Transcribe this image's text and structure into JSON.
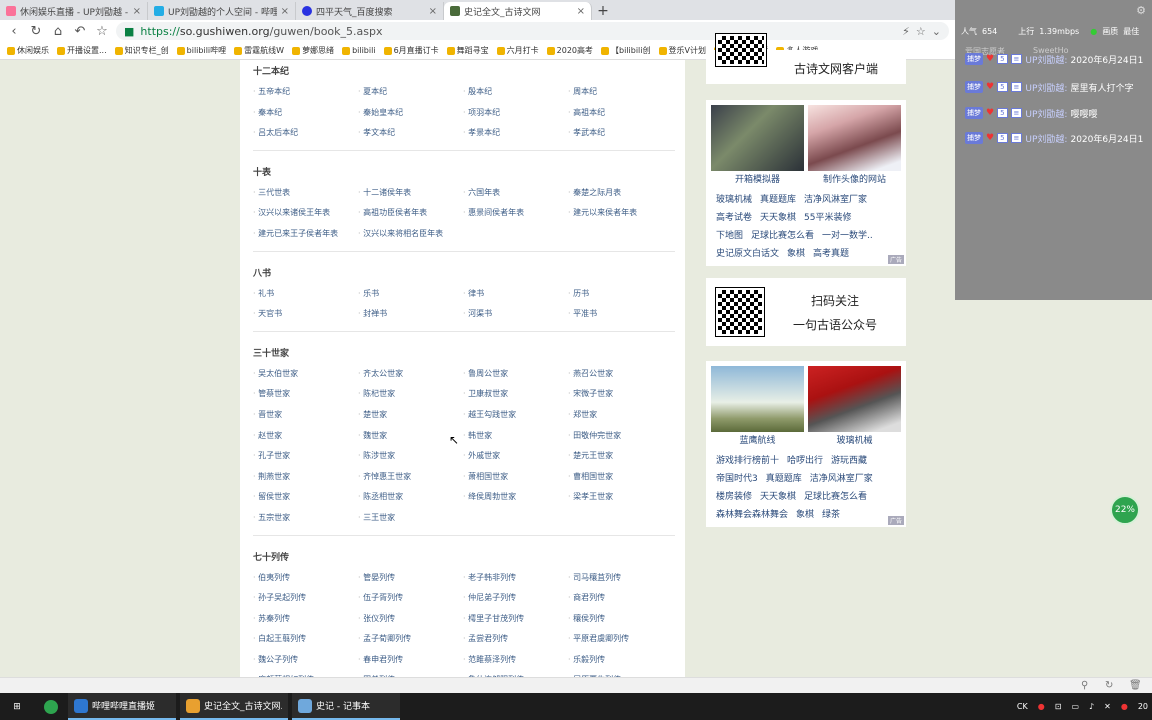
{
  "browser": {
    "tabs": [
      {
        "label": "休闲娱乐直播 - UP刘勖越 - 哔哩",
        "color": "#fb7299",
        "active": false
      },
      {
        "label": "UP刘勖越的个人空间 - 哔哩哔哩",
        "color": "#23ade5",
        "active": false
      },
      {
        "label": "四平天气_百度搜索",
        "color": "#2932e1",
        "active": false
      },
      {
        "label": "史记全文_古诗文网",
        "color": "#4a6b3a",
        "active": true
      }
    ],
    "new_tab": "+",
    "nav": {
      "back": "‹",
      "forward": "›",
      "reload": "↻",
      "home": "⌂",
      "undo": "↶",
      "star": "☆"
    },
    "url_secure": "https://",
    "url_host": "so.gushiwen.org",
    "url_path": "/guwen/book_5.aspx",
    "bookmarks": [
      "休闲娱乐",
      "开播设置...",
      "知识专栏_创",
      "bilibili哔哩",
      "雷霆航线W",
      "萝娜思绪",
      "bilibili",
      "6月直播订卡",
      "舞蹈寻宝",
      "六月打卡",
      "2020高考",
      "【bilibili创",
      "登乐V计划",
      "2019年高考",
      "多人游戏"
    ]
  },
  "content": {
    "sections": [
      {
        "title": "十二本纪",
        "links": [
          "五帝本纪",
          "夏本纪",
          "殷本纪",
          "周本纪",
          "秦本纪",
          "秦始皇本纪",
          "项羽本纪",
          "高祖本纪",
          "吕太后本纪",
          "孝文本纪",
          "孝景本纪",
          "孝武本纪"
        ]
      },
      {
        "title": "十表",
        "links": [
          "三代世表",
          "十二诸侯年表",
          "六国年表",
          "秦楚之际月表",
          "汉兴以来诸侯王年表",
          "高祖功臣侯者年表",
          "惠景间侯者年表",
          "建元以来侯者年表",
          "建元已来王子侯者年表",
          "汉兴以来将相名臣年表"
        ]
      },
      {
        "title": "八书",
        "links": [
          "礼书",
          "乐书",
          "律书",
          "历书",
          "天官书",
          "封禅书",
          "河渠书",
          "平准书"
        ]
      },
      {
        "title": "三十世家",
        "links": [
          "吴太伯世家",
          "齐太公世家",
          "鲁周公世家",
          "燕召公世家",
          "管蔡世家",
          "陈杞世家",
          "卫康叔世家",
          "宋微子世家",
          "晋世家",
          "楚世家",
          "越王勾践世家",
          "郑世家",
          "赵世家",
          "魏世家",
          "韩世家",
          "田敬仲完世家",
          "孔子世家",
          "陈涉世家",
          "外戚世家",
          "楚元王世家",
          "荆燕世家",
          "齐悼惠王世家",
          "萧相国世家",
          "曹相国世家",
          "留侯世家",
          "陈丞相世家",
          "绛侯周勃世家",
          "梁孝王世家",
          "五宗世家",
          "三王世家"
        ]
      },
      {
        "title": "七十列传",
        "links": [
          "伯夷列传",
          "管晏列传",
          "老子韩非列传",
          "司马穰苴列传",
          "孙子吴起列传",
          "伍子胥列传",
          "仲尼弟子列传",
          "商君列传",
          "苏秦列传",
          "张仪列传",
          "樗里子甘茂列传",
          "穰侯列传",
          "白起王翦列传",
          "孟子荀卿列传",
          "孟尝君列传",
          "平原君虞卿列传",
          "魏公子列传",
          "春申君列传",
          "范雎蔡泽列传",
          "乐毅列传",
          "廉颇蔺相如列传",
          "田单列传",
          "鲁仲连邹阳列传",
          "屈原贾生列传"
        ]
      }
    ]
  },
  "sidebar": {
    "app_label": "古诗文网客户端",
    "ad1": {
      "captions": [
        "开箱模拟器",
        "制作头像的网站"
      ],
      "links": [
        [
          "玻璃机械",
          "真题题库",
          "洁净风淋室厂家"
        ],
        [
          "高考试卷",
          "天天象棋",
          "55平米装修"
        ],
        [
          "下地图",
          "足球比赛怎么看",
          "一对一数学.."
        ],
        [
          "史记原文白话文",
          "象棋",
          "高考真题"
        ]
      ]
    },
    "follow": {
      "line1": "扫码关注",
      "line2": "一句古语公众号"
    },
    "ad2": {
      "captions": [
        "蓝鹰航线",
        "玻璃机械"
      ],
      "links": [
        [
          "游戏排行榜前十",
          "哈啰出行",
          "游玩西藏"
        ],
        [
          "帝国时代3",
          "真题题库",
          "洁净风淋室厂家"
        ],
        [
          "楼房装修",
          "天天象棋",
          "足球比赛怎么看"
        ],
        [
          "森林舞会森林舞会",
          "象棋",
          "绿茶"
        ]
      ]
    },
    "ad_tag": "广告"
  },
  "overlay": {
    "popularity": "人气",
    "popularity_value": "654",
    "upload": "上行",
    "upload_value": "1.39mbps",
    "quality": "画质",
    "quality_value": "最佳",
    "partial_top": "爱国志愿者",
    "partial_name": "SweetHo",
    "danmaku": [
      {
        "badge": "捕梦",
        "level": "5",
        "name": "UP刘勖越:",
        "text": "2020年6月24日1"
      },
      {
        "badge": "捕梦",
        "level": "5",
        "name": "UP刘勖越:",
        "text": "屋里有人打个字"
      },
      {
        "badge": "捕梦",
        "level": "5",
        "name": "UP刘勖越:",
        "text": "嘤嘤嘤"
      },
      {
        "badge": "捕梦",
        "level": "5",
        "name": "UP刘勖越:",
        "text": "2020年6月24日1"
      }
    ],
    "cpu_percent": "22%"
  },
  "taskbar": {
    "apps": [
      {
        "label": "哔哩哔哩直播姬",
        "color": "#2e77d0"
      },
      {
        "label": "史记全文_古诗文网...",
        "color": "#e8a030"
      },
      {
        "label": "史记 - 记事本",
        "color": "#6fa8dc"
      }
    ],
    "tray_lang": "CK",
    "tray_clock": "20"
  }
}
